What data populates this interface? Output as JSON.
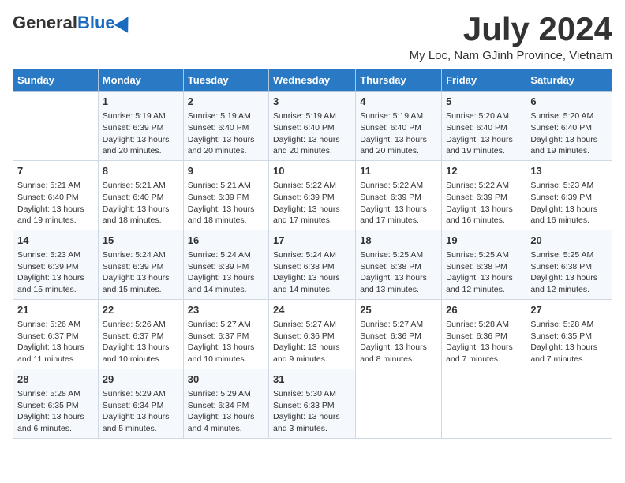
{
  "header": {
    "logo_general": "General",
    "logo_blue": "Blue",
    "month_title": "July 2024",
    "location": "My Loc, Nam GJinh Province, Vietnam"
  },
  "days_of_week": [
    "Sunday",
    "Monday",
    "Tuesday",
    "Wednesday",
    "Thursday",
    "Friday",
    "Saturday"
  ],
  "weeks": [
    [
      {
        "day": "",
        "info": ""
      },
      {
        "day": "1",
        "info": "Sunrise: 5:19 AM\nSunset: 6:39 PM\nDaylight: 13 hours\nand 20 minutes."
      },
      {
        "day": "2",
        "info": "Sunrise: 5:19 AM\nSunset: 6:40 PM\nDaylight: 13 hours\nand 20 minutes."
      },
      {
        "day": "3",
        "info": "Sunrise: 5:19 AM\nSunset: 6:40 PM\nDaylight: 13 hours\nand 20 minutes."
      },
      {
        "day": "4",
        "info": "Sunrise: 5:19 AM\nSunset: 6:40 PM\nDaylight: 13 hours\nand 20 minutes."
      },
      {
        "day": "5",
        "info": "Sunrise: 5:20 AM\nSunset: 6:40 PM\nDaylight: 13 hours\nand 19 minutes."
      },
      {
        "day": "6",
        "info": "Sunrise: 5:20 AM\nSunset: 6:40 PM\nDaylight: 13 hours\nand 19 minutes."
      }
    ],
    [
      {
        "day": "7",
        "info": "Sunrise: 5:21 AM\nSunset: 6:40 PM\nDaylight: 13 hours\nand 19 minutes."
      },
      {
        "day": "8",
        "info": "Sunrise: 5:21 AM\nSunset: 6:40 PM\nDaylight: 13 hours\nand 18 minutes."
      },
      {
        "day": "9",
        "info": "Sunrise: 5:21 AM\nSunset: 6:39 PM\nDaylight: 13 hours\nand 18 minutes."
      },
      {
        "day": "10",
        "info": "Sunrise: 5:22 AM\nSunset: 6:39 PM\nDaylight: 13 hours\nand 17 minutes."
      },
      {
        "day": "11",
        "info": "Sunrise: 5:22 AM\nSunset: 6:39 PM\nDaylight: 13 hours\nand 17 minutes."
      },
      {
        "day": "12",
        "info": "Sunrise: 5:22 AM\nSunset: 6:39 PM\nDaylight: 13 hours\nand 16 minutes."
      },
      {
        "day": "13",
        "info": "Sunrise: 5:23 AM\nSunset: 6:39 PM\nDaylight: 13 hours\nand 16 minutes."
      }
    ],
    [
      {
        "day": "14",
        "info": "Sunrise: 5:23 AM\nSunset: 6:39 PM\nDaylight: 13 hours\nand 15 minutes."
      },
      {
        "day": "15",
        "info": "Sunrise: 5:24 AM\nSunset: 6:39 PM\nDaylight: 13 hours\nand 15 minutes."
      },
      {
        "day": "16",
        "info": "Sunrise: 5:24 AM\nSunset: 6:39 PM\nDaylight: 13 hours\nand 14 minutes."
      },
      {
        "day": "17",
        "info": "Sunrise: 5:24 AM\nSunset: 6:38 PM\nDaylight: 13 hours\nand 14 minutes."
      },
      {
        "day": "18",
        "info": "Sunrise: 5:25 AM\nSunset: 6:38 PM\nDaylight: 13 hours\nand 13 minutes."
      },
      {
        "day": "19",
        "info": "Sunrise: 5:25 AM\nSunset: 6:38 PM\nDaylight: 13 hours\nand 12 minutes."
      },
      {
        "day": "20",
        "info": "Sunrise: 5:25 AM\nSunset: 6:38 PM\nDaylight: 13 hours\nand 12 minutes."
      }
    ],
    [
      {
        "day": "21",
        "info": "Sunrise: 5:26 AM\nSunset: 6:37 PM\nDaylight: 13 hours\nand 11 minutes."
      },
      {
        "day": "22",
        "info": "Sunrise: 5:26 AM\nSunset: 6:37 PM\nDaylight: 13 hours\nand 10 minutes."
      },
      {
        "day": "23",
        "info": "Sunrise: 5:27 AM\nSunset: 6:37 PM\nDaylight: 13 hours\nand 10 minutes."
      },
      {
        "day": "24",
        "info": "Sunrise: 5:27 AM\nSunset: 6:36 PM\nDaylight: 13 hours\nand 9 minutes."
      },
      {
        "day": "25",
        "info": "Sunrise: 5:27 AM\nSunset: 6:36 PM\nDaylight: 13 hours\nand 8 minutes."
      },
      {
        "day": "26",
        "info": "Sunrise: 5:28 AM\nSunset: 6:36 PM\nDaylight: 13 hours\nand 7 minutes."
      },
      {
        "day": "27",
        "info": "Sunrise: 5:28 AM\nSunset: 6:35 PM\nDaylight: 13 hours\nand 7 minutes."
      }
    ],
    [
      {
        "day": "28",
        "info": "Sunrise: 5:28 AM\nSunset: 6:35 PM\nDaylight: 13 hours\nand 6 minutes."
      },
      {
        "day": "29",
        "info": "Sunrise: 5:29 AM\nSunset: 6:34 PM\nDaylight: 13 hours\nand 5 minutes."
      },
      {
        "day": "30",
        "info": "Sunrise: 5:29 AM\nSunset: 6:34 PM\nDaylight: 13 hours\nand 4 minutes."
      },
      {
        "day": "31",
        "info": "Sunrise: 5:30 AM\nSunset: 6:33 PM\nDaylight: 13 hours\nand 3 minutes."
      },
      {
        "day": "",
        "info": ""
      },
      {
        "day": "",
        "info": ""
      },
      {
        "day": "",
        "info": ""
      }
    ]
  ]
}
